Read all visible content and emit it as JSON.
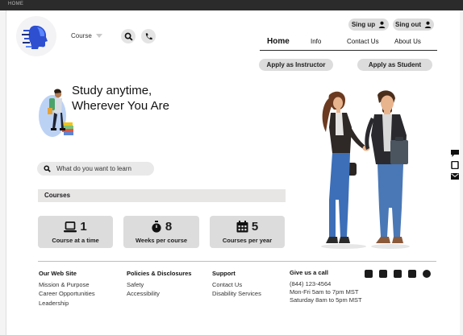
{
  "window": {
    "title": "HOME"
  },
  "header": {
    "course_select": "Course",
    "sign_up": "Sing up",
    "sign_out": "Sing out"
  },
  "nav": {
    "home": "Home",
    "info": "Info",
    "contact": "Contact Us",
    "about": "About Us"
  },
  "actions": {
    "apply_instructor": "Apply as Instructor",
    "apply_student": "Apply as Student"
  },
  "hero": {
    "title_line1": "Study anytime,",
    "title_line2": "Wherever You Are"
  },
  "search": {
    "placeholder": "What do you want to learn"
  },
  "courses": {
    "heading": "Courses",
    "stats": [
      {
        "value": "1",
        "label": "Course at a time",
        "icon": "laptop-icon"
      },
      {
        "value": "8",
        "label": "Weeks per course",
        "icon": "stopwatch-icon"
      },
      {
        "value": "5",
        "label": "Courses per year",
        "icon": "calendar-icon"
      }
    ]
  },
  "side_icons": [
    "chat-icon",
    "tablet-icon",
    "mail-icon"
  ],
  "footer": {
    "website": {
      "heading": "Our Web Site",
      "links": [
        "Mission & Purpose",
        "Career Opportunities",
        "Leadership"
      ]
    },
    "policies": {
      "heading": "Policies & Disclosures",
      "links": [
        "Safety",
        "Accessibility"
      ]
    },
    "support": {
      "heading": "Support",
      "links": [
        "Contact Us",
        "Disability Services"
      ]
    },
    "call": {
      "heading": "Give us a call",
      "lines": [
        "(844) 123-4564",
        "Mon-Fri 5am to 7pm MST",
        "Saturday 8am to 5pm MST"
      ]
    },
    "social_icons": [
      "contact-card-icon",
      "linkedin-icon",
      "phone-icon",
      "youtube-icon",
      "skype-icon"
    ]
  },
  "colors": {
    "pill": "#dcdcdc",
    "stat_card": "#dcdcdc",
    "strip": "#e8e5e5",
    "accent_blue": "#2d4fd0",
    "shirt_blue": "#3d6fb8"
  }
}
